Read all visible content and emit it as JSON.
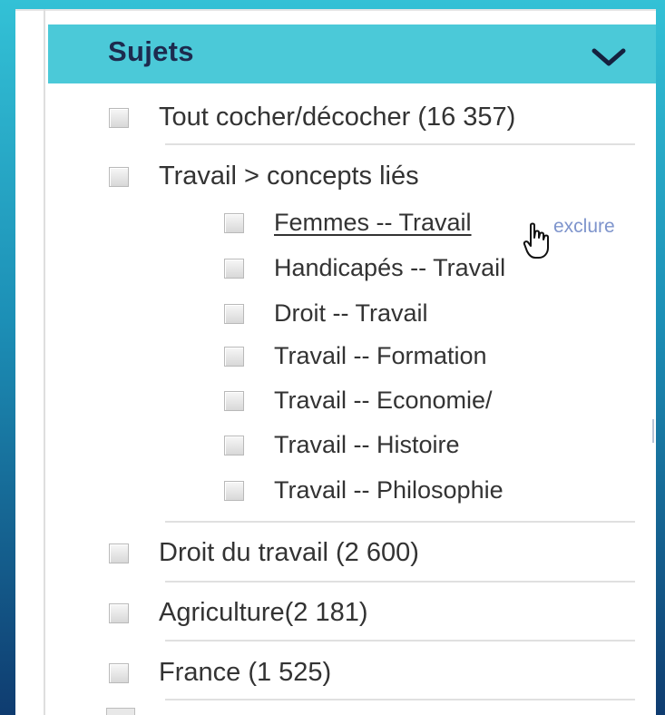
{
  "facet": {
    "title": "Sujets",
    "toggle_icon": "chevron-down-icon"
  },
  "items": {
    "all": "Tout cocher/décocher (16 357)",
    "travail": "Travail > concepts liés",
    "droit_du_travail": "Droit du travail (2 600)",
    "agriculture": "Agriculture(2 181)",
    "france": "France (1 525)"
  },
  "related": [
    "Femmes -- Travail",
    "Handicapés -- Travail",
    "Droit -- Travail",
    "Travail -- Formation",
    "Travail -- Economie/",
    "Travail -- Histoire",
    "Travail -- Philosophie"
  ],
  "hover_action": "exclure",
  "colors": {
    "header_bg": "#4bc9d8",
    "header_text": "#1d2a4e",
    "exclude_link": "#7e94cc"
  }
}
